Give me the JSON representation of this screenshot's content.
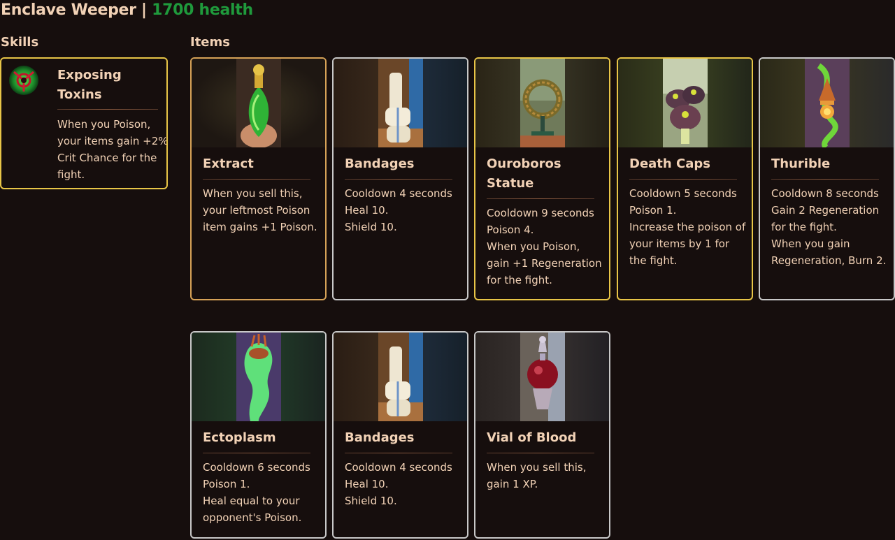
{
  "header": {
    "name": "Enclave Weeper |",
    "health": "1700 health"
  },
  "sections": {
    "skills": "Skills",
    "items": "Items"
  },
  "skill": {
    "name_lines": [
      "Exposing",
      "Toxins"
    ],
    "desc_lines": [
      "When you Poison,",
      "your items gain +2%",
      "Crit Chance for the",
      "fight."
    ],
    "icon": "toxin-icon"
  },
  "items": [
    {
      "name_lines": [
        "Extract"
      ],
      "desc_lines": [
        "When you sell this,",
        "your leftmost Poison",
        "item gains +1 Poison."
      ],
      "tier_color": "#d6a257",
      "icon": "potion-icon"
    },
    {
      "name_lines": [
        "Bandages"
      ],
      "desc_lines": [
        "Cooldown 4 seconds",
        "Heal 10.",
        "Shield 10."
      ],
      "tier_color": "#c8c8c8",
      "icon": "bandage-icon"
    },
    {
      "name_lines": [
        "Ouroboros",
        "Statue"
      ],
      "desc_lines": [
        "Cooldown 9 seconds",
        "Poison 4.",
        "When you Poison,",
        "gain +1 Regeneration",
        "for the fight."
      ],
      "tier_color": "#e8c547",
      "icon": "ouroboros-icon"
    },
    {
      "name_lines": [
        "Death Caps"
      ],
      "desc_lines": [
        "Cooldown 5 seconds",
        "Poison 1.",
        "Increase the poison of",
        "your items by 1 for",
        "the fight."
      ],
      "tier_color": "#e8c547",
      "icon": "mushroom-icon"
    },
    {
      "name_lines": [
        "Thurible"
      ],
      "desc_lines": [
        "Cooldown 8 seconds",
        "Gain 2 Regeneration",
        "for the fight.",
        "When you gain",
        "Regeneration, Burn 2."
      ],
      "tier_color": "#c8c8c8",
      "icon": "thurible-icon"
    },
    {
      "name_lines": [
        "Ectoplasm"
      ],
      "desc_lines": [
        "Cooldown 6 seconds",
        "Poison 1.",
        "Heal equal to your",
        "opponent's Poison."
      ],
      "tier_color": "#c8c8c8",
      "icon": "ectoplasm-icon"
    },
    {
      "name_lines": [
        "Bandages"
      ],
      "desc_lines": [
        "Cooldown 4 seconds",
        "Heal 10.",
        "Shield 10."
      ],
      "tier_color": "#c8c8c8",
      "icon": "bandage-icon"
    },
    {
      "name_lines": [
        "Vial of Blood"
      ],
      "desc_lines": [
        "When you sell this,",
        "gain 1 XP."
      ],
      "tier_color": "#c8c8c8",
      "icon": "blood-vial-icon"
    }
  ]
}
